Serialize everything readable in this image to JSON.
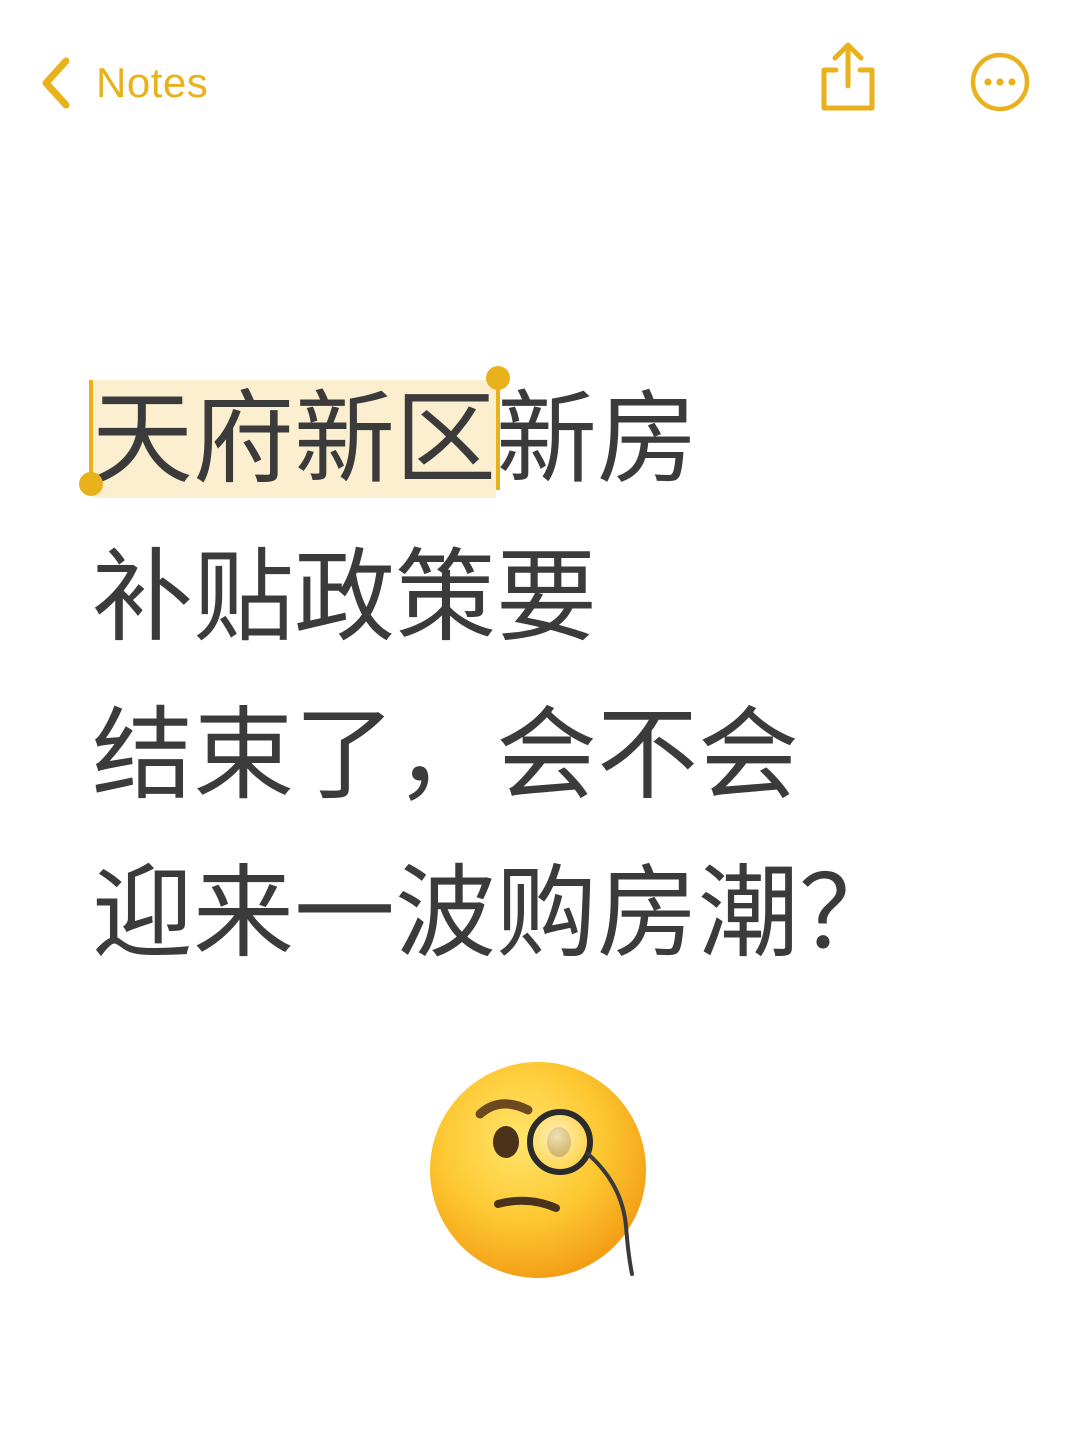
{
  "nav": {
    "back_label": "Notes",
    "accent_color": "#E9B21D",
    "share_icon": "share-icon",
    "more_icon": "ellipsis-circle-icon"
  },
  "note": {
    "line1_selected": "天府新区",
    "line1_rest": "新房",
    "line2": "补贴政策要",
    "line3": "结束了，会不会",
    "line4": "迎来一波购房潮？",
    "selection_color": "#FBEFCF",
    "emoji": "face-with-monocle"
  }
}
